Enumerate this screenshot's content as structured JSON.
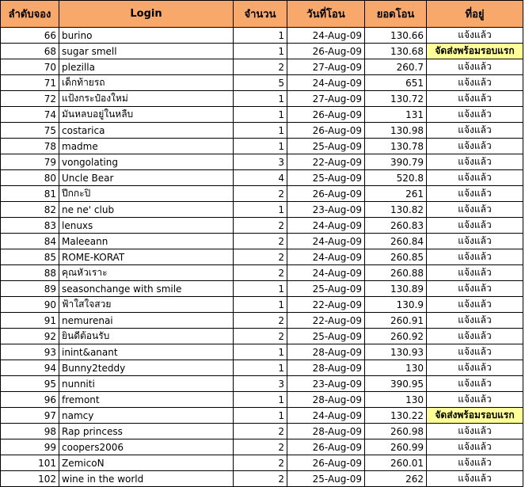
{
  "columns": [
    "ลำดับจอง",
    "Login",
    "จำนวน",
    "วันที่โอน",
    "ยอดโอน",
    "ที่อยู่"
  ],
  "highlight_color": "#ffff99",
  "header_color": "#f7a86a",
  "rows": [
    {
      "no": "66",
      "login": "burino",
      "qty": "1",
      "date": "24-Aug-09",
      "amount": "130.66",
      "status": "แจ้งแล้ว",
      "hl": false
    },
    {
      "no": "68",
      "login": "sugar smell",
      "qty": "1",
      "date": "26-Aug-09",
      "amount": "130.68",
      "status": "จัดส่งพร้อมรอบแรก",
      "hl": true
    },
    {
      "no": "70",
      "login": "plezilla",
      "qty": "2",
      "date": "27-Aug-09",
      "amount": "260.7",
      "status": "แจ้งแล้ว",
      "hl": false
    },
    {
      "no": "71",
      "login": "เด็กท้ายรถ",
      "qty": "5",
      "date": "24-Aug-09",
      "amount": "651",
      "status": "แจ้งแล้ว",
      "hl": false
    },
    {
      "no": "72",
      "login": "แป้งกระป๋องใหม่",
      "qty": "1",
      "date": "27-Aug-09",
      "amount": "130.72",
      "status": "แจ้งแล้ว",
      "hl": false
    },
    {
      "no": "74",
      "login": "มันหลบอยู่ในหลืบ",
      "qty": "1",
      "date": "26-Aug-09",
      "amount": "131",
      "status": "แจ้งแล้ว",
      "hl": false
    },
    {
      "no": "75",
      "login": "costarica",
      "qty": "1",
      "date": "26-Aug-09",
      "amount": "130.98",
      "status": "แจ้งแล้ว",
      "hl": false
    },
    {
      "no": "78",
      "login": "madme",
      "qty": "1",
      "date": "25-Aug-09",
      "amount": "130.78",
      "status": "แจ้งแล้ว",
      "hl": false
    },
    {
      "no": "79",
      "login": "vongolating",
      "qty": "3",
      "date": "22-Aug-09",
      "amount": "390.79",
      "status": "แจ้งแล้ว",
      "hl": false
    },
    {
      "no": "80",
      "login": "Uncle Bear",
      "qty": "4",
      "date": "25-Aug-09",
      "amount": "520.8",
      "status": "แจ้งแล้ว",
      "hl": false
    },
    {
      "no": "81",
      "login": "ปีกกะปิ",
      "qty": "2",
      "date": "26-Aug-09",
      "amount": "261",
      "status": "แจ้งแล้ว",
      "hl": false
    },
    {
      "no": "82",
      "login": "ne ne' club",
      "qty": "1",
      "date": "23-Aug-09",
      "amount": "130.82",
      "status": "แจ้งแล้ว",
      "hl": false
    },
    {
      "no": "83",
      "login": "lenuxs",
      "qty": "2",
      "date": "24-Aug-09",
      "amount": "260.83",
      "status": "แจ้งแล้ว",
      "hl": false
    },
    {
      "no": "84",
      "login": "Maleeann",
      "qty": "2",
      "date": "24-Aug-09",
      "amount": "260.84",
      "status": "แจ้งแล้ว",
      "hl": false
    },
    {
      "no": "85",
      "login": "ROME-KORAT",
      "qty": "2",
      "date": "24-Aug-09",
      "amount": "260.85",
      "status": "แจ้งแล้ว",
      "hl": false
    },
    {
      "no": "88",
      "login": "คุณหัวเราะ",
      "qty": "2",
      "date": "24-Aug-09",
      "amount": "260.88",
      "status": "แจ้งแล้ว",
      "hl": false
    },
    {
      "no": "89",
      "login": "seasonchange with smile",
      "qty": "1",
      "date": "25-Aug-09",
      "amount": "130.89",
      "status": "แจ้งแล้ว",
      "hl": false
    },
    {
      "no": "90",
      "login": "ฟ้าใสใจสวย",
      "qty": "1",
      "date": "22-Aug-09",
      "amount": "130.9",
      "status": "แจ้งแล้ว",
      "hl": false
    },
    {
      "no": "91",
      "login": "nemurenai",
      "qty": "2",
      "date": "22-Aug-09",
      "amount": "260.91",
      "status": "แจ้งแล้ว",
      "hl": false
    },
    {
      "no": "92",
      "login": "ยินดีต้อนรับ",
      "qty": "2",
      "date": "25-Aug-09",
      "amount": "260.92",
      "status": "แจ้งแล้ว",
      "hl": false
    },
    {
      "no": "93",
      "login": "inint&anant",
      "qty": "1",
      "date": "28-Aug-09",
      "amount": "130.93",
      "status": "แจ้งแล้ว",
      "hl": false
    },
    {
      "no": "94",
      "login": "Bunny2teddy",
      "qty": "1",
      "date": "28-Aug-09",
      "amount": "130",
      "status": "แจ้งแล้ว",
      "hl": false
    },
    {
      "no": "95",
      "login": "nunniti",
      "qty": "3",
      "date": "23-Aug-09",
      "amount": "390.95",
      "status": "แจ้งแล้ว",
      "hl": false
    },
    {
      "no": "96",
      "login": "fremont",
      "qty": "1",
      "date": "28-Aug-09",
      "amount": "130",
      "status": "แจ้งแล้ว",
      "hl": false
    },
    {
      "no": "97",
      "login": "namcy",
      "qty": "1",
      "date": "24-Aug-09",
      "amount": "130.22",
      "status": "จัดส่งพร้อมรอบแรก",
      "hl": true
    },
    {
      "no": "98",
      "login": "Rap princess",
      "qty": "2",
      "date": "28-Aug-09",
      "amount": "260.98",
      "status": "แจ้งแล้ว",
      "hl": false
    },
    {
      "no": "99",
      "login": "coopers2006",
      "qty": "2",
      "date": "26-Aug-09",
      "amount": "260.99",
      "status": "แจ้งแล้ว",
      "hl": false
    },
    {
      "no": "101",
      "login": "ZemicoN",
      "qty": "2",
      "date": "26-Aug-09",
      "amount": "260.01",
      "status": "แจ้งแล้ว",
      "hl": false
    },
    {
      "no": "102",
      "login": "wine in the world",
      "qty": "2",
      "date": "25-Aug-09",
      "amount": "262",
      "status": "แจ้งแล้ว",
      "hl": false
    }
  ]
}
